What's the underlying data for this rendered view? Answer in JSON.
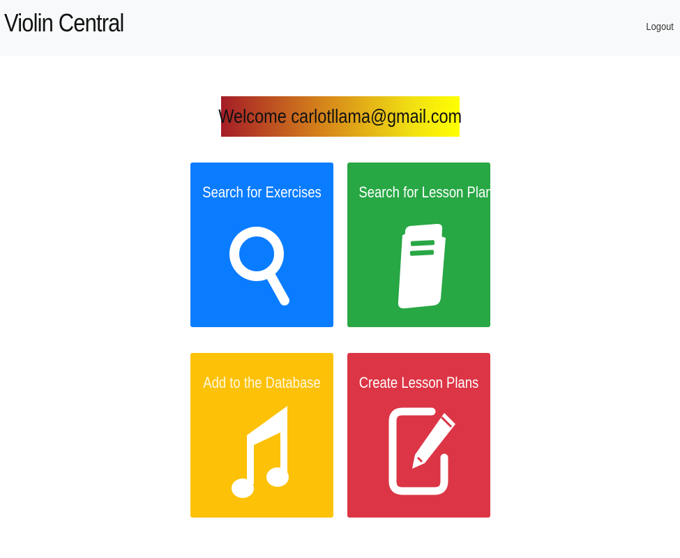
{
  "navbar": {
    "brand": "Violin Central",
    "logout_label": "Logout"
  },
  "welcome": {
    "text": "Welcome carlotllama@gmail.com"
  },
  "tiles": [
    {
      "label": "Search for Exercises",
      "icon": "search-icon",
      "color": "#0a7cff"
    },
    {
      "label": "Search for Lesson Plans",
      "icon": "book-icon",
      "color": "#28a745"
    },
    {
      "label": "Add to the Database",
      "icon": "music-note-icon",
      "color": "#fdc107"
    },
    {
      "label": "Create Lesson Plans",
      "icon": "edit-icon",
      "color": "#dc3545"
    }
  ]
}
